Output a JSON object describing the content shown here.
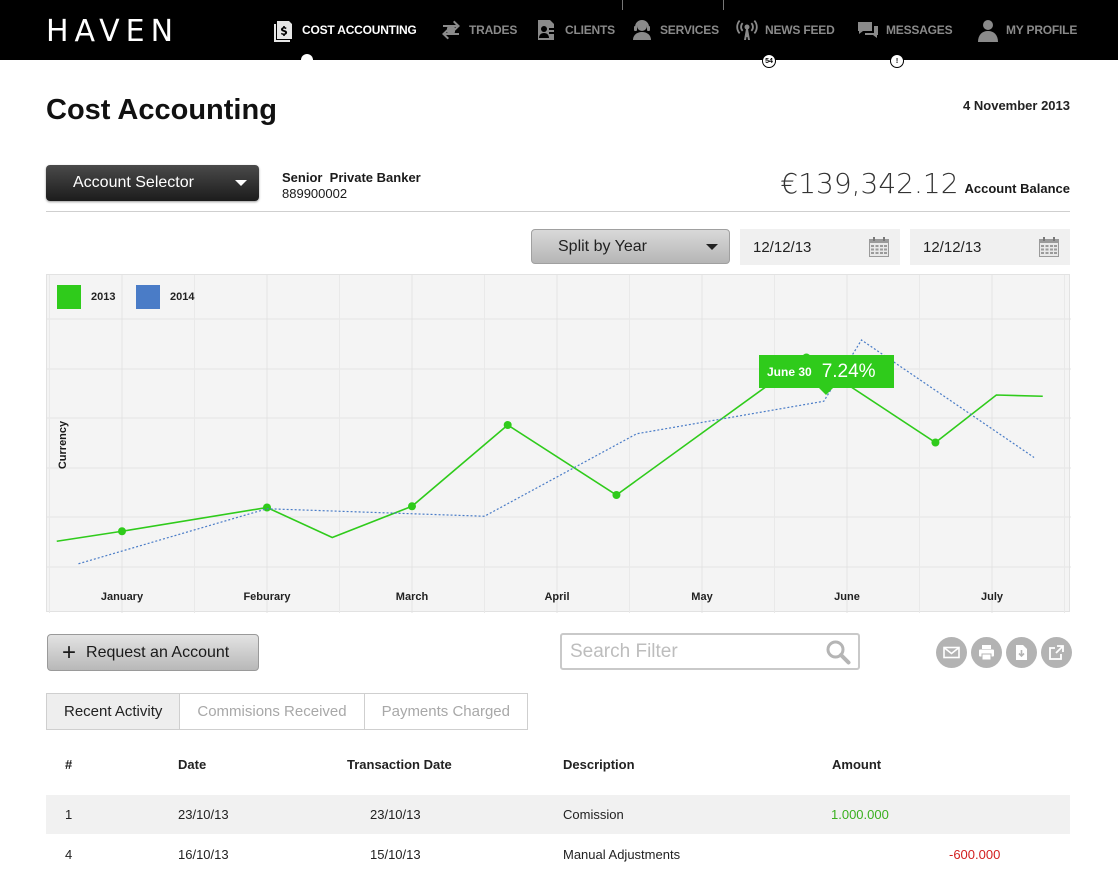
{
  "app": {
    "logo": "HAVEN"
  },
  "nav": [
    {
      "label": "COST ACCOUNTING",
      "icon": "dollar-document-icon",
      "active": true
    },
    {
      "label": "TRADES",
      "icon": "exchange-icon"
    },
    {
      "label": "CLIENTS",
      "icon": "client-card-icon"
    },
    {
      "label": "SERVICES",
      "icon": "support-agent-icon"
    },
    {
      "label": "NEWS FEED",
      "icon": "broadcast-icon",
      "badge": "54"
    },
    {
      "label": "MESSAGES",
      "icon": "chat-bubbles-icon",
      "badge": "!"
    },
    {
      "label": "MY PROFILE",
      "icon": "user-icon"
    }
  ],
  "page": {
    "title": "Cost Accounting",
    "date": "4 November 2013"
  },
  "account": {
    "selector_label": "Account Selector",
    "role": "Senior  Private Banker",
    "id": "889900002",
    "balance": "€139,342.12",
    "balance_label": "Account Balance"
  },
  "filters": {
    "split_label": "Split by Year",
    "date_from": "12/12/13",
    "date_to": "12/12/13"
  },
  "colors": {
    "series_2013": "#2fcb1b",
    "series_2014": "#4a7cc7"
  },
  "chart_data": {
    "type": "line",
    "categories": [
      "January",
      "Feburary",
      "March",
      "April",
      "May",
      "June",
      "July"
    ],
    "ylabel": "Currency",
    "series": [
      {
        "name": "2013",
        "values": [
          [
            -0.45,
            0.95
          ],
          [
            0,
            1.35
          ],
          [
            1,
            2.3
          ],
          [
            1.45,
            1.1
          ],
          [
            2,
            2.35
          ],
          [
            2.66,
            5.6
          ],
          [
            3.41,
            2.8
          ],
          [
            4.72,
            8.3
          ],
          [
            5.61,
            4.9
          ],
          [
            6.03,
            6.8
          ],
          [
            6.35,
            6.75
          ]
        ]
      },
      {
        "name": "2014",
        "values": [
          [
            -0.3,
            0.05
          ],
          [
            1,
            2.25
          ],
          [
            2.5,
            1.95
          ],
          [
            3.55,
            5.25
          ],
          [
            4.84,
            6.55
          ],
          [
            5.1,
            9.0
          ],
          [
            6.29,
            4.3
          ]
        ]
      }
    ],
    "highlight": {
      "label": "June 30",
      "value": "7.24%"
    }
  },
  "actions": {
    "request_label": "Request an Account",
    "search_placeholder": "Search Filter",
    "icons": [
      "email-icon",
      "print-icon",
      "download-icon",
      "external-link-icon"
    ]
  },
  "tabs": [
    {
      "label": "Recent Activity",
      "active": true
    },
    {
      "label": "Commisions Received"
    },
    {
      "label": "Payments Charged"
    }
  ],
  "table": {
    "headers": [
      "#",
      "Date",
      "Transaction Date",
      "Description",
      "Amount"
    ],
    "rows": [
      {
        "num": "1",
        "date": "23/10/13",
        "tdate": "23/10/13",
        "desc": "Comission",
        "amount": "1.000.000",
        "sign": "pos"
      },
      {
        "num": "4",
        "date": "16/10/13",
        "tdate": "15/10/13",
        "desc": "Manual Adjustments",
        "amount": "-600.000",
        "sign": "neg"
      }
    ]
  }
}
